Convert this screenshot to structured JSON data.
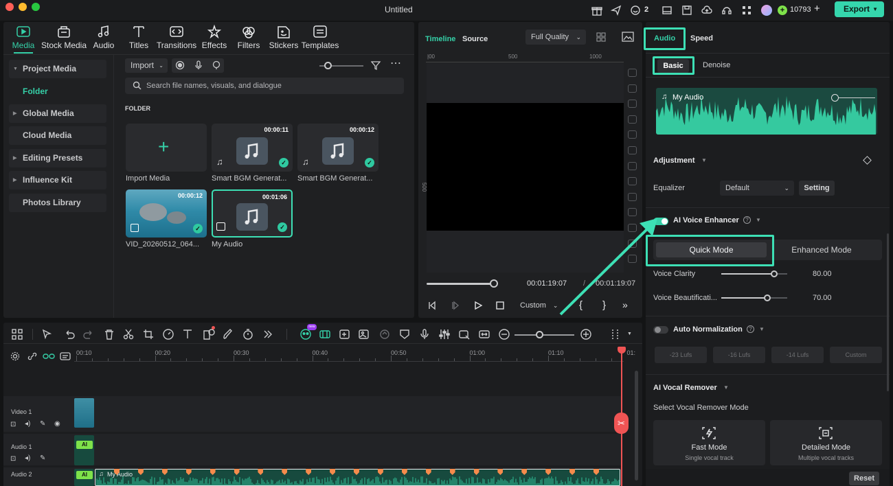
{
  "window": {
    "title": "Untitled"
  },
  "titlebar": {
    "notif_count": "2",
    "credits": "10793",
    "export_label": "Export",
    "icons": [
      "gift-icon",
      "send-icon",
      "headset-icon",
      "layout-icon",
      "save-icon",
      "cloud-upload-icon",
      "support-icon",
      "grid-icon",
      "avatar"
    ]
  },
  "toolbar": {
    "tabs": [
      {
        "label": "Media",
        "icon": "media-icon"
      },
      {
        "label": "Stock Media",
        "icon": "stock-media-icon"
      },
      {
        "label": "Audio",
        "icon": "audio-icon"
      },
      {
        "label": "Titles",
        "icon": "titles-icon"
      },
      {
        "label": "Transitions",
        "icon": "transitions-icon"
      },
      {
        "label": "Effects",
        "icon": "effects-icon"
      },
      {
        "label": "Filters",
        "icon": "filters-icon"
      },
      {
        "label": "Stickers",
        "icon": "stickers-icon"
      },
      {
        "label": "Templates",
        "icon": "templates-icon"
      }
    ]
  },
  "sidebar": {
    "items": [
      {
        "label": "Project Media"
      },
      {
        "label": "Folder"
      },
      {
        "label": "Global Media"
      },
      {
        "label": "Cloud Media"
      },
      {
        "label": "Editing Presets"
      },
      {
        "label": "Influence Kit"
      },
      {
        "label": "Photos Library"
      }
    ]
  },
  "media": {
    "import_label": "Import",
    "search_placeholder": "Search file names, visuals, and dialogue",
    "folder_heading": "FOLDER",
    "items": [
      {
        "label": "Import Media"
      },
      {
        "label": "Smart BGM Generat...",
        "duration": "00:00:11"
      },
      {
        "label": "Smart BGM Generat...",
        "duration": "00:00:12"
      },
      {
        "label": "VID_20260512_064...",
        "duration": "00:00:12"
      },
      {
        "label": "My Audio",
        "duration": "00:01:06"
      }
    ]
  },
  "player": {
    "tab_timeline": "Timeline",
    "tab_source": "Source",
    "quality": "Full Quality",
    "ruler": [
      "|00",
      "500",
      "1000"
    ],
    "vruler": [
      "500"
    ],
    "current_time": "00:01:19:07",
    "total_time": "00:01:19:07",
    "separator": "/",
    "custom_label": "Custom",
    "progress": 0.97
  },
  "right": {
    "tab_audio": "Audio",
    "tab_speed": "Speed",
    "sub_basic": "Basic",
    "sub_denoise": "Denoise",
    "clip_name": "My Audio",
    "adjustment": "Adjustment",
    "equalizer_label": "Equalizer",
    "equalizer_value": "Default",
    "setting_label": "Setting",
    "ai_voice": "AI Voice Enhancer",
    "quick_mode": "Quick Mode",
    "enhanced_mode": "Enhanced Mode",
    "voice_clarity_label": "Voice Clarity",
    "voice_clarity_value": "80.00",
    "voice_clarity": 0.8,
    "voice_beaut_label": "Voice Beautificati...",
    "voice_beaut_value": "70.00",
    "voice_beaut": 0.7,
    "auto_norm": "Auto Normalization",
    "lufs": [
      "-23 Lufs",
      "-16 Lufs",
      "-14 Lufs",
      "Custom"
    ],
    "vocal_remover": "AI Vocal Remover",
    "vocal_mode_label": "Select Vocal Remover Mode",
    "fast_mode": "Fast Mode",
    "fast_mode_sub": "Single vocal track",
    "detailed_mode": "Detailed Mode",
    "detailed_mode_sub": "Multiple vocal tracks",
    "reset_label": "Reset"
  },
  "timeline": {
    "ruler": [
      "00:10",
      "00:20",
      "00:30",
      "00:40",
      "00:50",
      "01:00",
      "01:10",
      "01:"
    ],
    "tracks": [
      {
        "label": "Video 1"
      },
      {
        "label": "Audio 1"
      },
      {
        "label": "Audio 2"
      }
    ],
    "clip_label": "My Audio",
    "ai_badge": "AI",
    "new_badge": "new"
  },
  "colors": {
    "accent": "#35d0a8",
    "highlight": "#3de0b5",
    "playhead": "#f05454",
    "export": "#35d6ad"
  }
}
